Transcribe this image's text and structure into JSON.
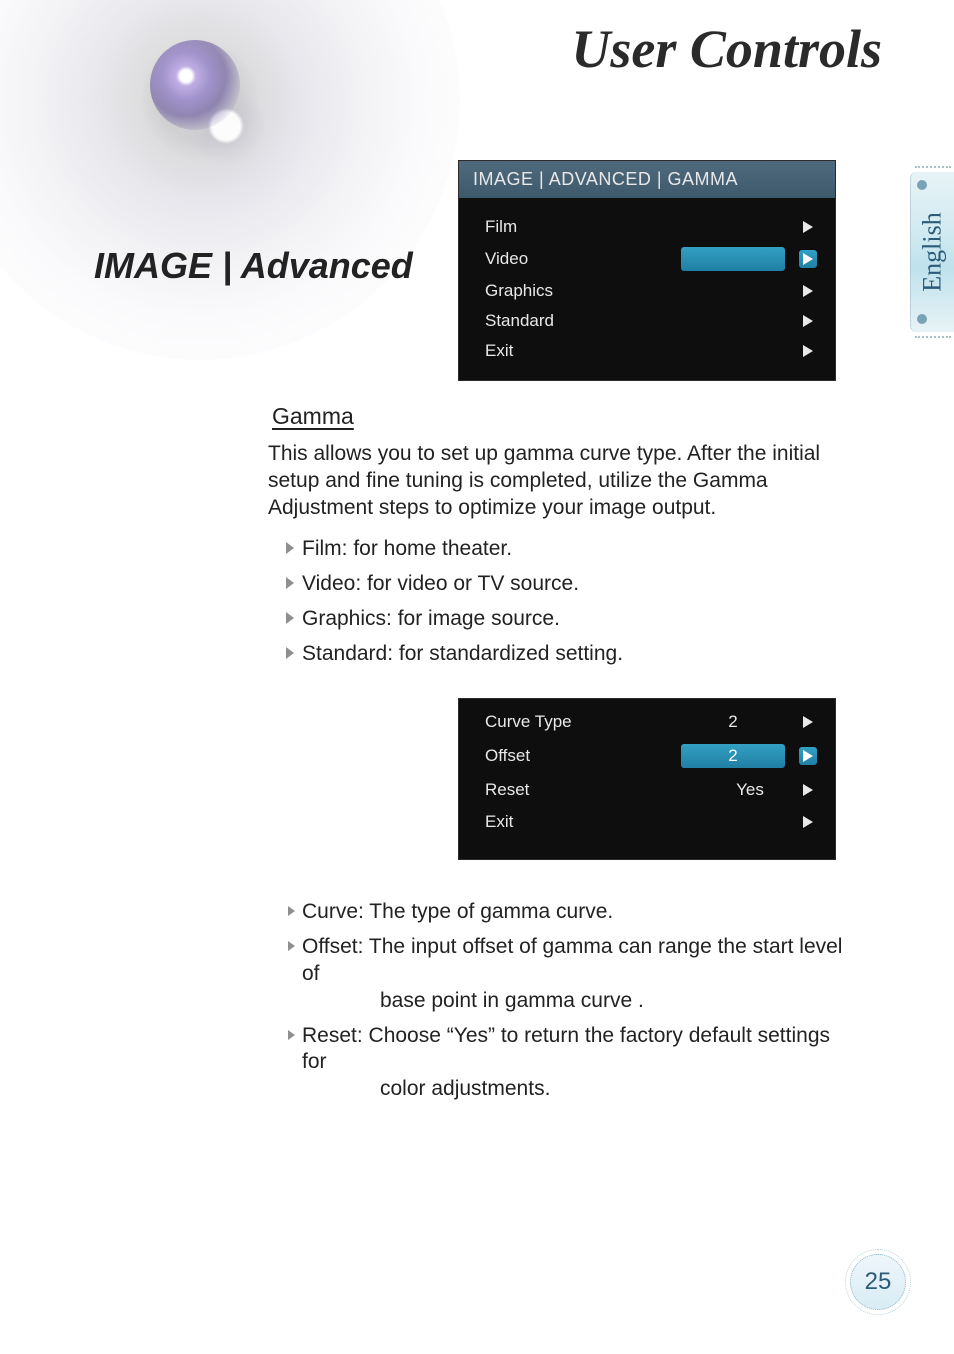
{
  "banner": {
    "title": "User Controls"
  },
  "sideTab": {
    "label": "English"
  },
  "sectionHeading": "IMAGE | Advanced",
  "osd1": {
    "header": "IMAGE | ADVANCED | GAMMA",
    "items": [
      {
        "label": "Film",
        "selected": false
      },
      {
        "label": "Video",
        "selected": true
      },
      {
        "label": "Graphics",
        "selected": false
      },
      {
        "label": "Standard",
        "selected": false
      },
      {
        "label": "Exit",
        "selected": false
      }
    ]
  },
  "gamma": {
    "heading": "Gamma",
    "intro": "This allows you to set up gamma curve type. After the initial setup and fine tuning is completed, utilize the Gamma Adjustment steps to optimize your image output.",
    "bullets": [
      "Film: for home theater.",
      "Video: for video or TV source.",
      "Graphics: for image source.",
      "Standard: for standardized setting."
    ]
  },
  "osd2": {
    "items": [
      {
        "label": "Curve Type",
        "value": "2",
        "selected": false
      },
      {
        "label": "Offset",
        "value": "2",
        "selected": true
      },
      {
        "label": "Reset",
        "value": "Yes",
        "selected": false
      },
      {
        "label": "Exit",
        "value": "",
        "selected": false
      }
    ]
  },
  "details": {
    "curve": "Curve: The type of gamma curve.",
    "offset_l1": "Offset: The input offset of gamma can range the start level of",
    "offset_l2": "base point in gamma curve .",
    "reset_l1": "Reset: Choose “Yes” to return the factory default settings for",
    "reset_l2": "color adjustments."
  },
  "pageNumber": "25"
}
